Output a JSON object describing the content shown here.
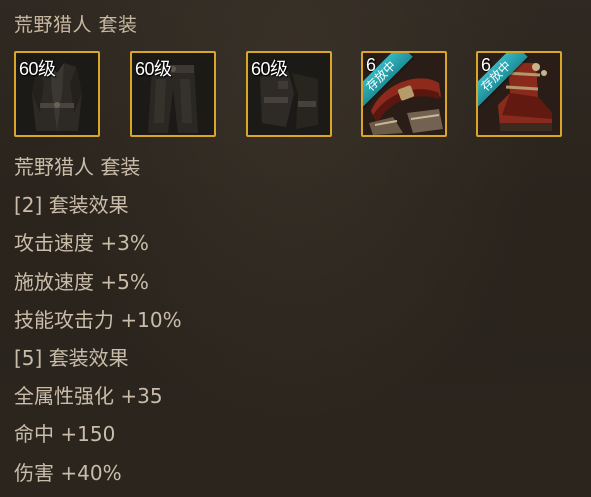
{
  "set_title": "荒野猎人  套装",
  "item_slots": [
    {
      "level_label": "60级",
      "badge": "",
      "icon": "dark-coat-icon",
      "accent": "#3a3632"
    },
    {
      "level_label": "60级",
      "badge": "",
      "icon": "dark-pants-icon",
      "accent": "#3a3632"
    },
    {
      "level_label": "60级",
      "badge": "",
      "icon": "dark-gloves-icon",
      "accent": "#3a3632"
    },
    {
      "level_label": "6",
      "badge": "存放中",
      "icon": "red-belt-icon",
      "accent": "#8e2a1c"
    },
    {
      "level_label": "6",
      "badge": "存放中",
      "icon": "red-boots-icon",
      "accent": "#8e2a1c"
    }
  ],
  "effects": {
    "set_name": "荒野猎人  套装",
    "lines": [
      "[2] 套装效果",
      "攻击速度 +3%",
      "施放速度 +5%",
      "技能攻击力 +10%",
      "[5] 套装效果",
      "全属性强化 +35",
      "命中 +150",
      "伤害 +40%"
    ]
  },
  "colors": {
    "frame_gold": "#d9a62a",
    "text": "#c9bca9",
    "badge_teal": "#1e8e99"
  }
}
